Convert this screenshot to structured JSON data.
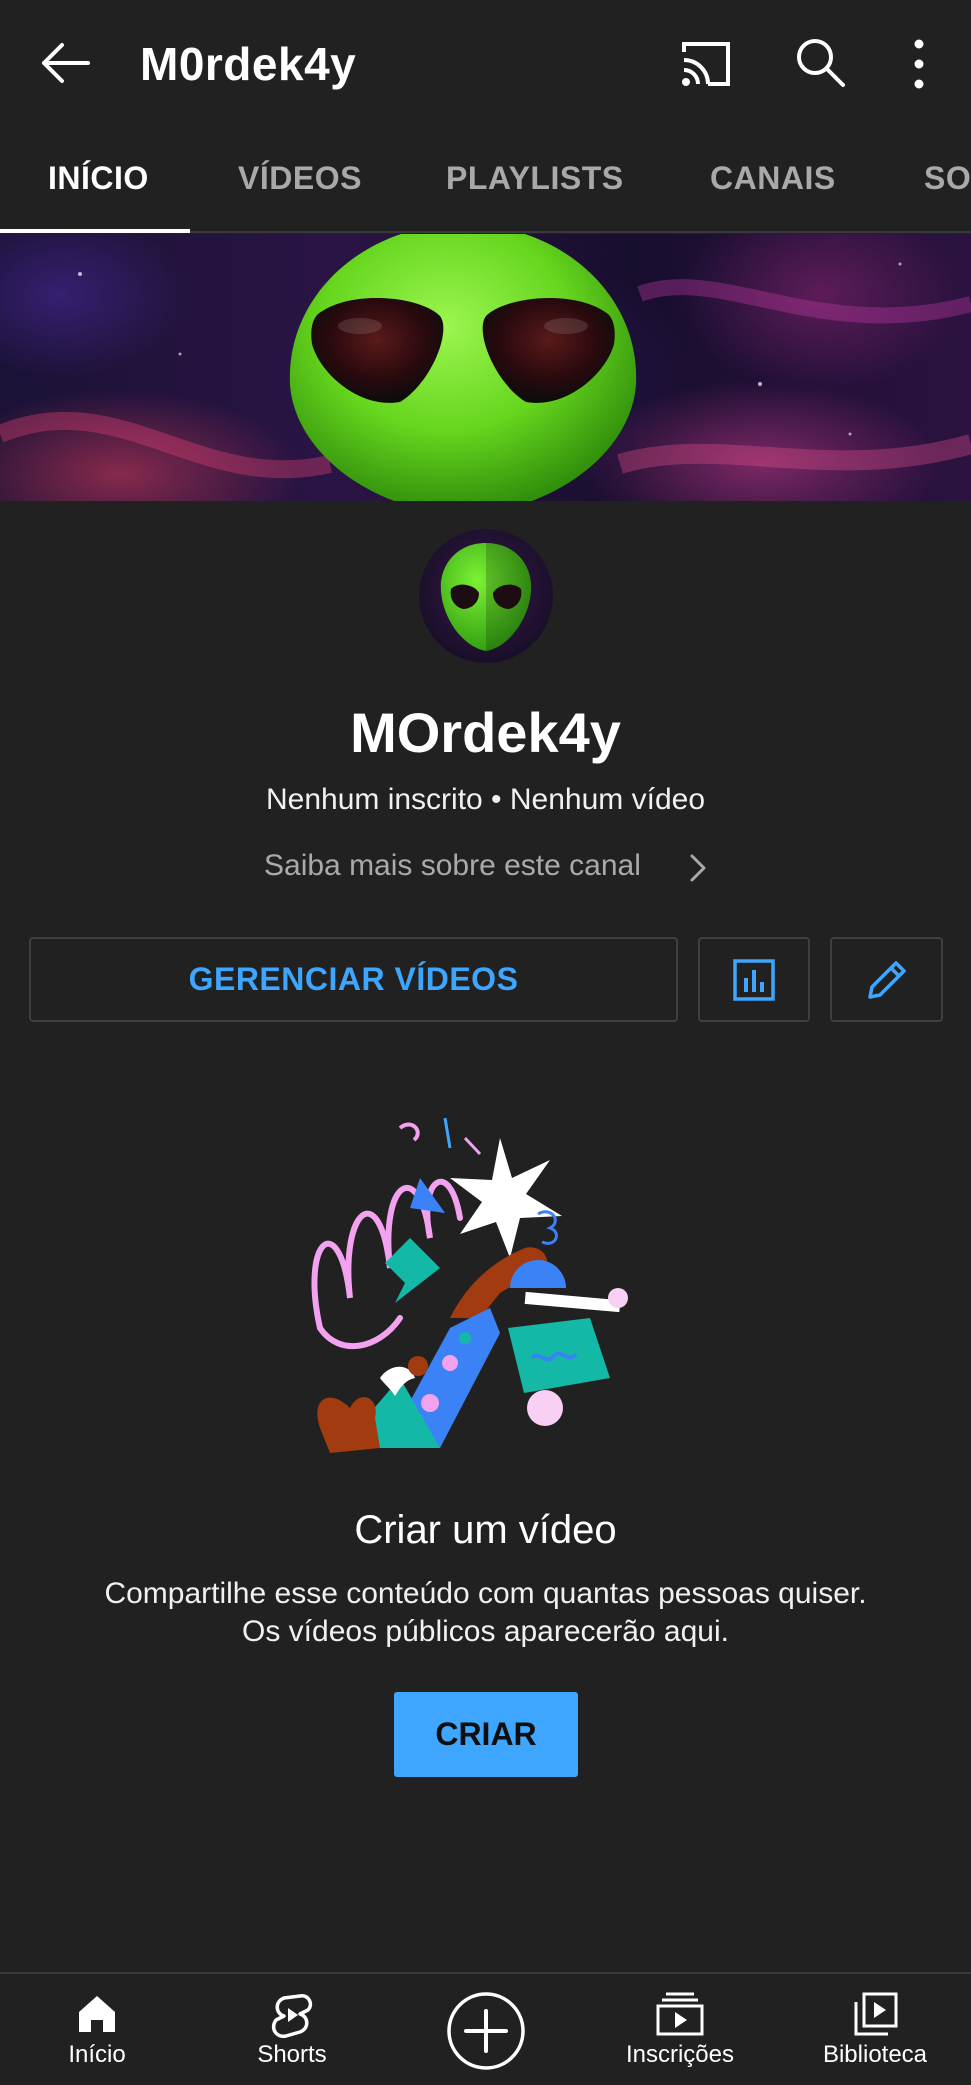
{
  "appbar": {
    "title": "M0rdek4y",
    "icons": [
      "back-arrow-icon",
      "cast-icon",
      "search-icon",
      "more-vert-icon"
    ]
  },
  "tabs": [
    {
      "label": "INÍCIO",
      "active": true
    },
    {
      "label": "VÍDEOS",
      "active": false
    },
    {
      "label": "PLAYLISTS",
      "active": false
    },
    {
      "label": "CANAIS",
      "active": false
    },
    {
      "label": "SOBRE",
      "active": false
    }
  ],
  "channel": {
    "name": "MOrdek4y",
    "stats": "Nenhum inscrito • Nenhum vídeo",
    "about_link": "Saiba mais sobre este canal"
  },
  "actions": {
    "manage_label": "GERENCIAR VÍDEOS",
    "analytics_icon": "analytics-icon",
    "edit_icon": "pencil-icon"
  },
  "empty_state": {
    "title": "Criar um vídeo",
    "description_line1": "Compartilhe esse conteúdo com quantas pessoas quiser.",
    "description_line2": "Os vídeos públicos aparecerão aqui.",
    "button_label": "CRIAR"
  },
  "bottom_nav": {
    "items": [
      {
        "label": "Início",
        "icon": "home-icon"
      },
      {
        "label": "Shorts",
        "icon": "shorts-icon"
      },
      {
        "label": "",
        "icon": "create-plus-icon"
      },
      {
        "label": "Inscrições",
        "icon": "subscriptions-icon"
      },
      {
        "label": "Biblioteca",
        "icon": "library-icon"
      }
    ]
  },
  "colors": {
    "background": "#212121",
    "accent_blue": "#3ea6ff",
    "alien_green": "#6fe02a",
    "muted_text": "#aaaaaa"
  }
}
